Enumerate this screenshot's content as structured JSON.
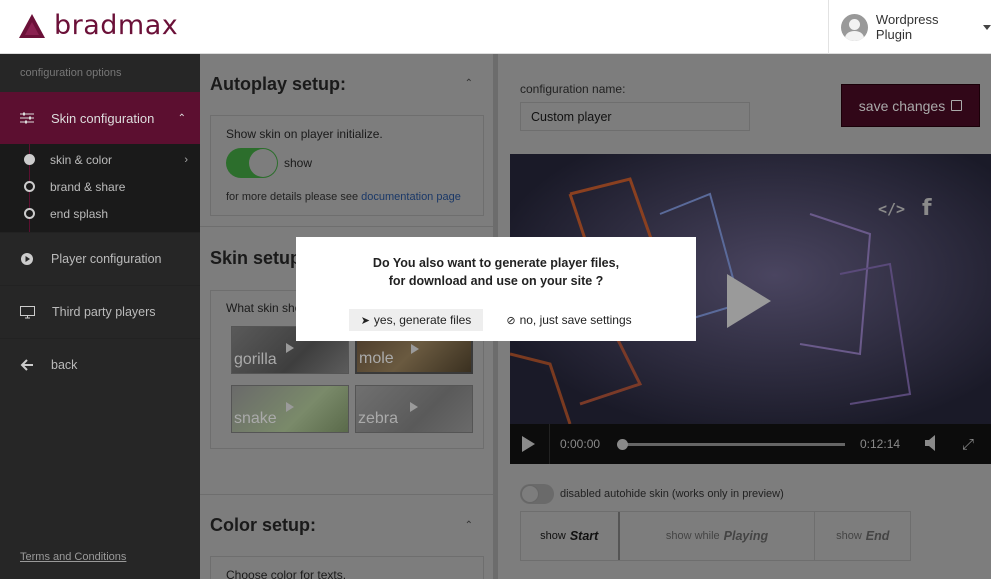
{
  "app": {
    "logo_text": "bradmax",
    "brand_color": "#6b1038"
  },
  "header": {
    "user_name": "Wordpress Plugin"
  },
  "sidebar": {
    "heading": "configuration options",
    "active_item": "Skin configuration",
    "sub_items": [
      "skin & color",
      "brand & share",
      "end splash"
    ],
    "items": [
      "Player configuration",
      "Third party players",
      "back"
    ],
    "terms": "Terms and Conditions"
  },
  "autoplay": {
    "title": "Autoplay setup:",
    "show_skin_text": "Show skin on player initialize.",
    "toggle_label": "show",
    "details_prefix": "for more details please see ",
    "details_link": "documentation page"
  },
  "skin": {
    "title": "Skin setup",
    "question": "What skin sho",
    "thumbs": [
      "gorilla",
      "mole",
      "snake",
      "zebra"
    ]
  },
  "color": {
    "title": "Color setup:",
    "choose_text": "Choose color for texts."
  },
  "config": {
    "name_label": "configuration name:",
    "name_value": "Custom player",
    "save_label": "save changes"
  },
  "player": {
    "current_time": "0:00:00",
    "duration": "0:12:14",
    "progress": 0
  },
  "preview": {
    "autohide_label": "disabled autohide skin (works only in preview)",
    "tabs": [
      {
        "prefix": "show",
        "name": "Start"
      },
      {
        "prefix": "show while",
        "name": "Playing"
      },
      {
        "prefix": "show",
        "name": "End"
      }
    ]
  },
  "modal": {
    "line1": "Do You also want to generate player files,",
    "line2": "for download and use on your site ?",
    "yes_label": "yes, generate files",
    "no_label": "no, just save settings"
  }
}
